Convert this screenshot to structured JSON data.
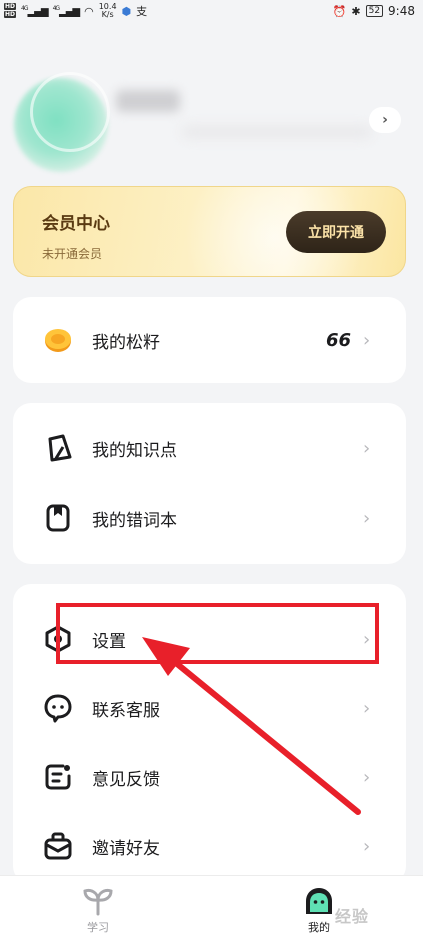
{
  "status_bar": {
    "hd_labels": [
      "HD",
      "HD"
    ],
    "signal1": "4G",
    "signal2": "4G",
    "net_speed_value": "10.4",
    "net_speed_unit": "K/s",
    "battery": "52",
    "time": "9:48"
  },
  "profile": {
    "arrow": "›"
  },
  "vip": {
    "title": "会员中心",
    "subtitle": "未开通会员",
    "button_label": "立即开通"
  },
  "seeds_card": {
    "label": "我的松籽",
    "value": "66"
  },
  "knowledge_card": {
    "items": [
      {
        "label": "我的知识点",
        "icon": "knowledge-icon"
      },
      {
        "label": "我的错词本",
        "icon": "wrongbook-icon"
      }
    ]
  },
  "settings_card": {
    "items": [
      {
        "label": "设置",
        "icon": "settings-icon"
      },
      {
        "label": "联系客服",
        "icon": "chat-icon"
      },
      {
        "label": "意见反馈",
        "icon": "feedback-icon"
      },
      {
        "label": "邀请好友",
        "icon": "invite-icon"
      }
    ]
  },
  "tabbar": {
    "tabs": [
      {
        "label": "学习",
        "icon": "sprout-icon",
        "active": false
      },
      {
        "label": "我的",
        "icon": "mascot-icon",
        "active": true
      }
    ]
  },
  "watermark": "经验",
  "colors": {
    "accent_red": "#e8202a",
    "vip_gold": "#fbe7a8",
    "vip_button": "#2e2418",
    "mascot_green": "#5fe0b4"
  }
}
